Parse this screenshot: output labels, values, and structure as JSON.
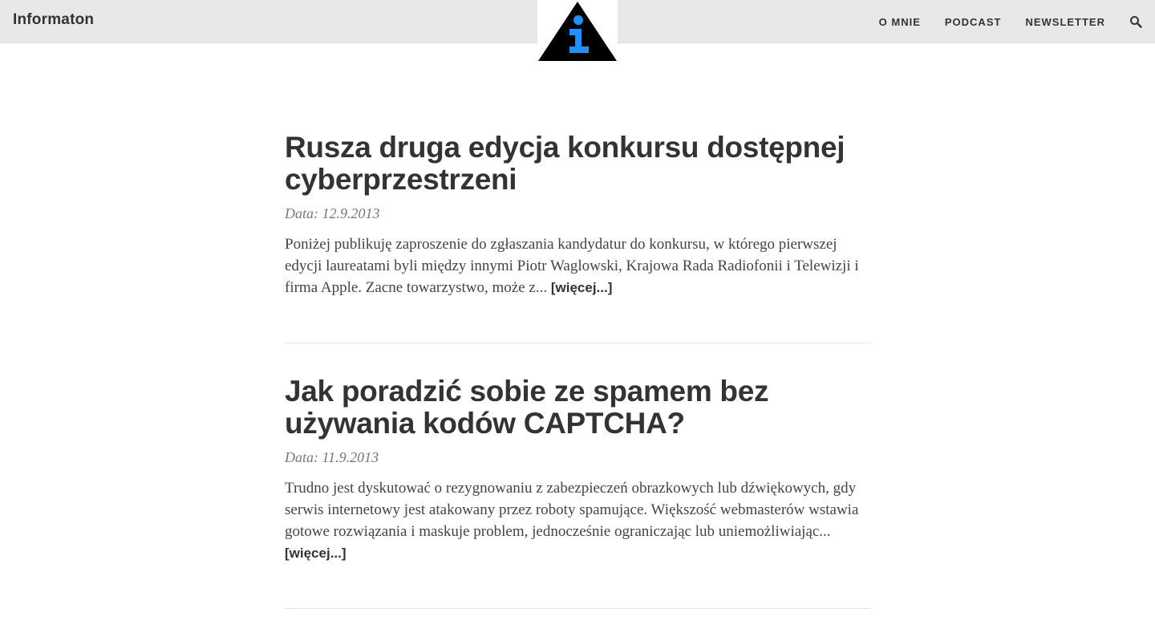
{
  "site": {
    "brand": "Informaton"
  },
  "nav": {
    "items": [
      {
        "label": "O MNIE"
      },
      {
        "label": "PODCAST"
      },
      {
        "label": "NEWSLETTER"
      }
    ],
    "search_icon": "search-icon"
  },
  "logo": {
    "icon": "info-triangle-logo",
    "colors": {
      "triangle": "#000000",
      "glyph": "#1e90ff"
    }
  },
  "posts": [
    {
      "title": "Rusza druga edycja konkursu dostępnej cyberprzestrzeni",
      "date": "Data: 12.9.2013",
      "excerpt": "Poniżej publikuję zaproszenie do zgłaszania kandydatur do konkursu, w którego pierwszej edycji laureatami byli między innymi Piotr Waglowski, Krajowa Rada Radiofonii i Telewizji i firma Apple. Zacne towarzystwo, może z... ",
      "more": "[więcej...]"
    },
    {
      "title": "Jak poradzić sobie ze spamem bez używania kodów CAPTCHA?",
      "date": "Data: 11.9.2013",
      "excerpt": "Trudno jest dyskutować o rezygnowaniu z zabezpieczeń obrazkowych lub dźwiękowych, gdy serwis internetowy jest atakowany przez roboty spamujące. Większość webmasterów wstawia gotowe rozwiązania i maskuje problem, jednocześnie ograniczając lub uniemożliwiając... ",
      "more": "[więcej...]"
    }
  ]
}
